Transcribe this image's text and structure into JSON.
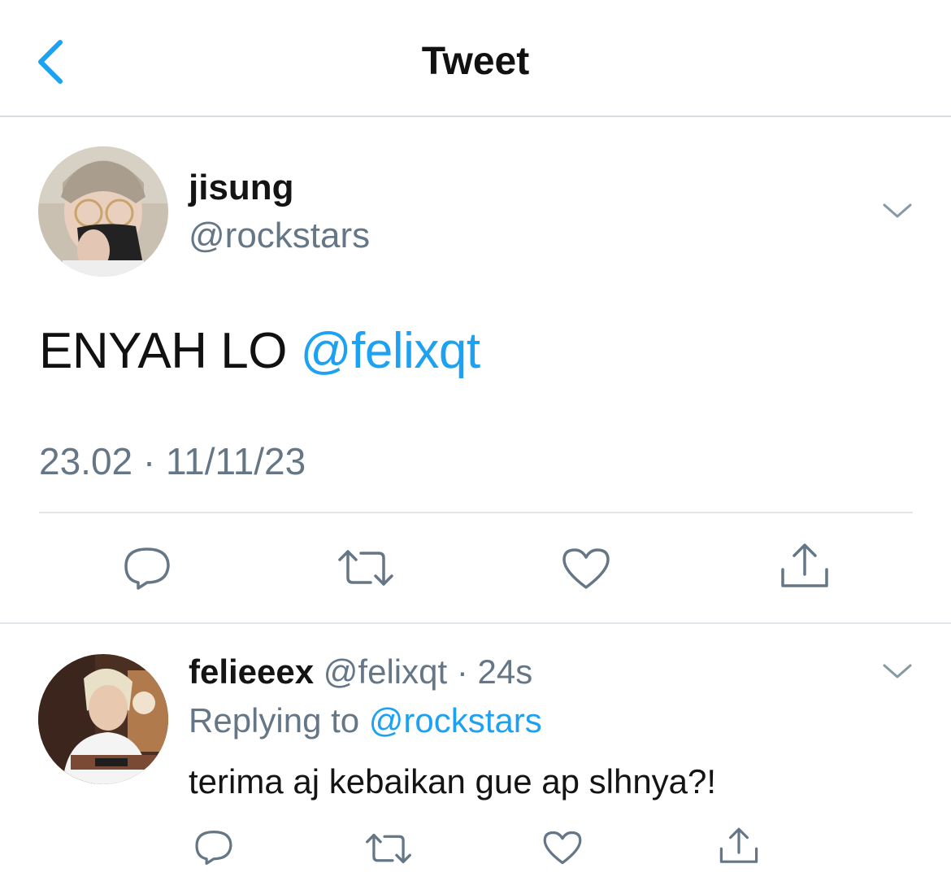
{
  "header": {
    "title": "Tweet"
  },
  "tweet": {
    "author_name": "jisung",
    "author_handle": "@rockstars",
    "text_prefix": "ENYAH LO ",
    "mention": "@felixqt",
    "timestamp": "23.02 · 11/11/23"
  },
  "reply": {
    "author_name": "felieeex",
    "author_handle": "@felixqt",
    "separator": " · ",
    "age": "24s",
    "replying_prefix": "Replying to ",
    "replying_to": "@rockstars",
    "text": "terima aj kebaikan gue ap slhnya?!"
  },
  "colors": {
    "accent": "#1da1f2",
    "secondary_text": "#657786",
    "icon": "#657786",
    "divider": "#e1e6ea"
  },
  "icons": [
    "back-chevron-icon",
    "chevron-down-icon",
    "reply-icon",
    "retweet-icon",
    "like-icon",
    "share-icon"
  ]
}
